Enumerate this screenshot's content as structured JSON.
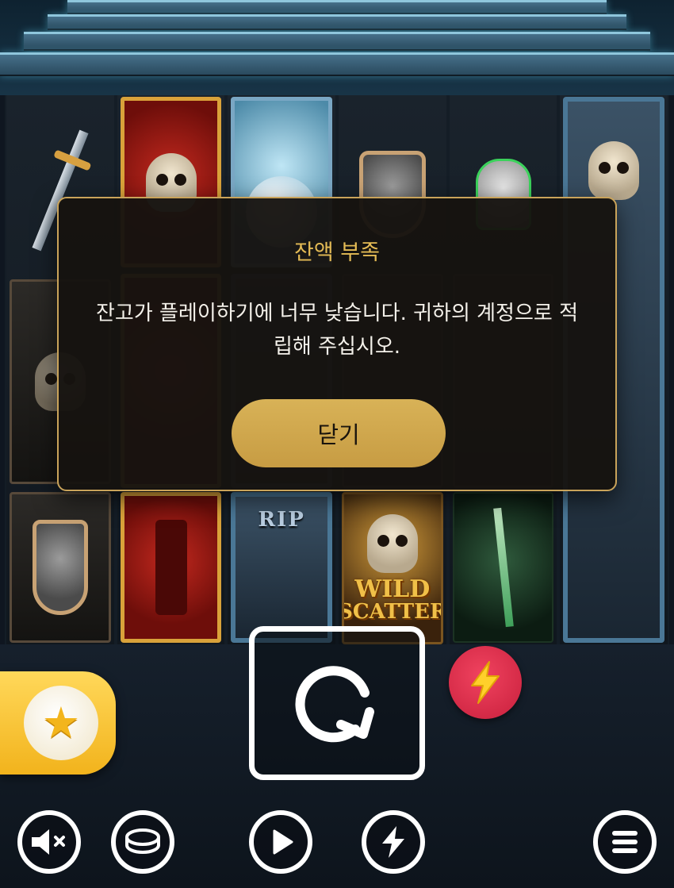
{
  "dialog": {
    "title": "잔액 부족",
    "message": "잔고가 플레이하기에 너무 낮습니다. 귀하의 계정으로 적립해 주십시오.",
    "close_label": "닫기"
  },
  "reels": {
    "tombstone_text": "RIP",
    "wild_line1": "WILD",
    "wild_line2": "SCATTER"
  },
  "controls": {
    "favorites_icon": "star-icon",
    "spin_icon": "spin-arrow-icon",
    "turbo_icon": "lightning-icon",
    "sound_icon": "speaker-muted-icon",
    "bet_icon": "coin-icon",
    "autoplay_icon": "play-icon",
    "quickspin_icon": "lightning-icon",
    "menu_icon": "menu-icon"
  },
  "colors": {
    "accent_gold": "#c9a35a",
    "dialog_title": "#e4bb55",
    "turbo_red": "#e0324e",
    "favorites_yellow": "#f6c12a"
  }
}
